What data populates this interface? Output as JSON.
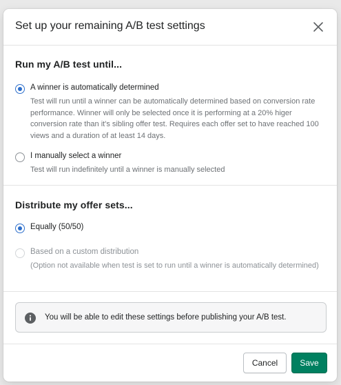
{
  "modal": {
    "title": "Set up your remaining A/B test settings"
  },
  "run_section": {
    "heading": "Run my A/B test until...",
    "options": [
      {
        "label": "A winner is automatically determined",
        "help": "Test will run until a winner can be automatically determined based on conversion rate performance. Winner will only be selected once it is performing at a 20% higer conversion rate than it's sibling offer test. Requires each offer set to have reached 100 views and a duration of at least 14 days.",
        "checked": true
      },
      {
        "label": "I manually select a winner",
        "help": "Test will run indefinitely until a winner is manually selected",
        "checked": false
      }
    ]
  },
  "distribute_section": {
    "heading": "Distribute my offer sets...",
    "options": [
      {
        "label": "Equally (50/50)",
        "checked": true,
        "disabled": false
      },
      {
        "label": "Based on a custom distribution",
        "help": "(Option not available when test is set to run until a winner is automatically determined)",
        "checked": false,
        "disabled": true
      }
    ]
  },
  "banner": {
    "icon": "info-icon",
    "text": "You will be able to edit these settings before publishing your A/B test."
  },
  "footer": {
    "cancel_label": "Cancel",
    "save_label": "Save"
  },
  "colors": {
    "accent": "#2c6ecb",
    "primary_button": "#008060"
  }
}
